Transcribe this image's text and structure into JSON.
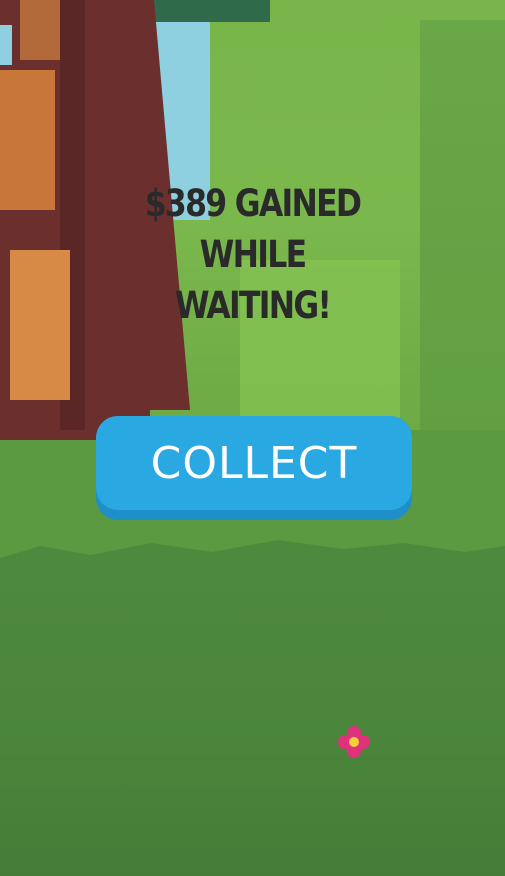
{
  "message": {
    "line1": "$389 GAINED WHILE",
    "line2": "WAITING!"
  },
  "collect_button": {
    "label": "COLLECT"
  },
  "colors": {
    "button": "#2aa8e2",
    "button_shadow": "#1f8fc8",
    "text": "#2a2a2a",
    "flower": "#e0317a"
  },
  "icons": {
    "flower": "flower-icon"
  }
}
